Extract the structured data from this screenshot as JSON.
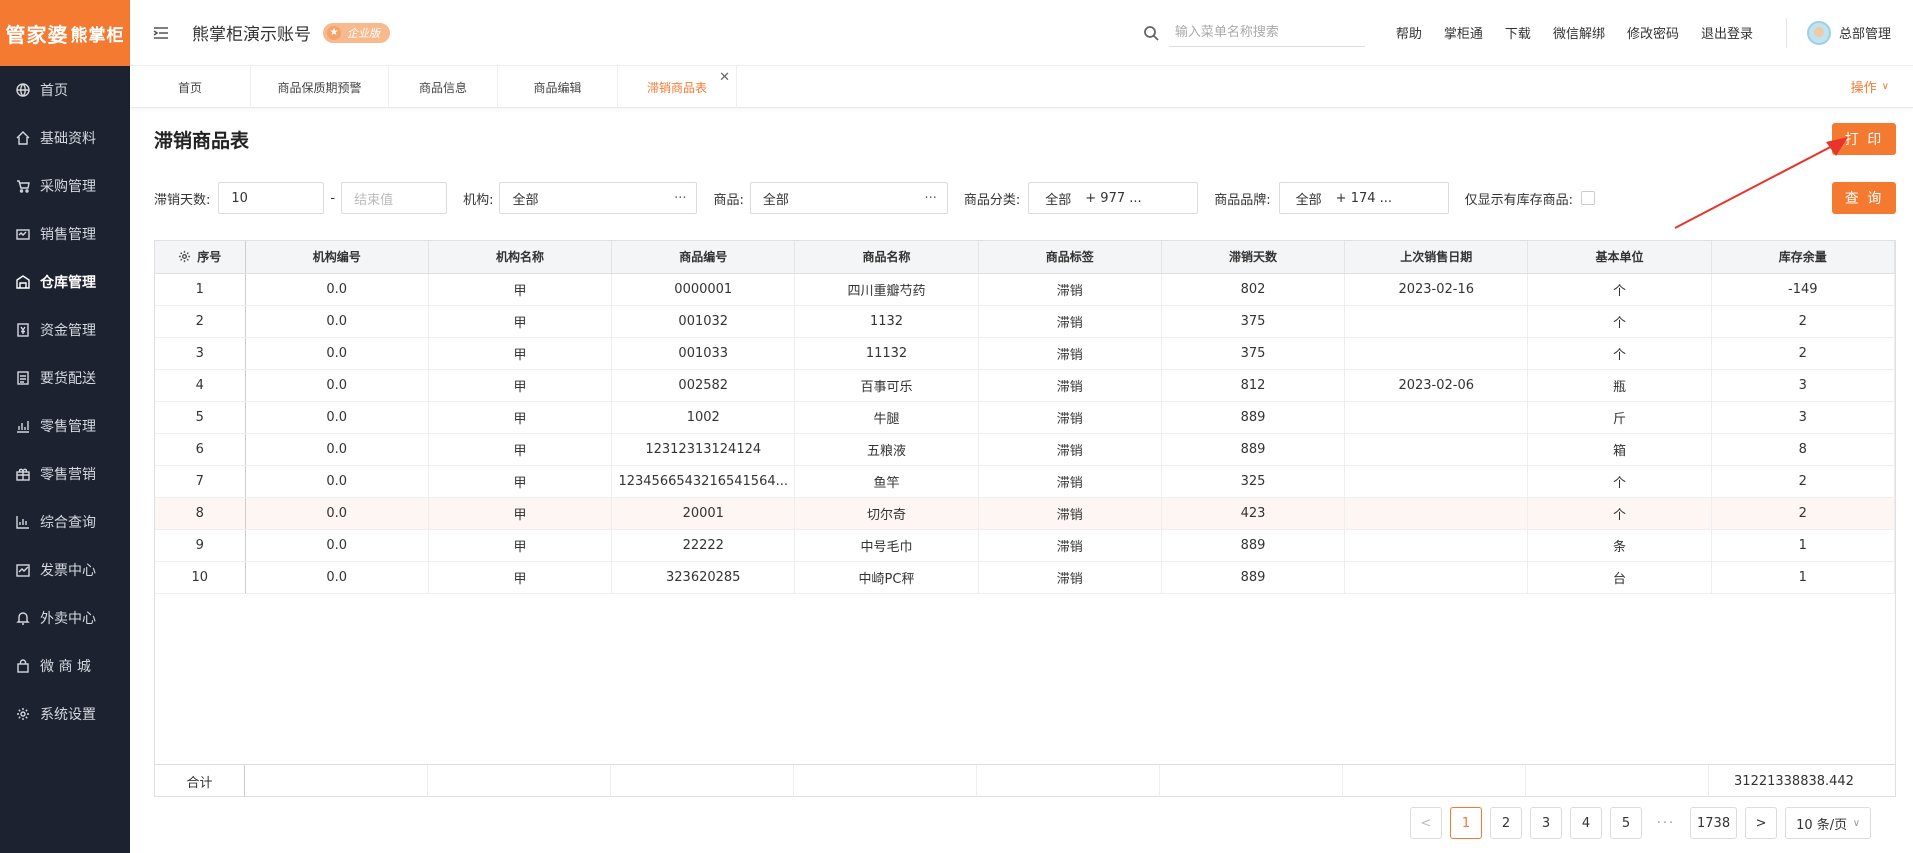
{
  "brand": {
    "logo_main": "管家婆",
    "logo_sub": "熊掌柜",
    "logo_color": "#f47a31"
  },
  "sidebar": {
    "items": [
      {
        "label": "首页",
        "icon": "globe-icon"
      },
      {
        "label": "基础资料",
        "icon": "home-icon"
      },
      {
        "label": "采购管理",
        "icon": "cart-icon"
      },
      {
        "label": "销售管理",
        "icon": "sales-icon"
      },
      {
        "label": "仓库管理",
        "icon": "warehouse-icon",
        "active": true
      },
      {
        "label": "资金管理",
        "icon": "money-icon"
      },
      {
        "label": "要货配送",
        "icon": "list-icon"
      },
      {
        "label": "零售管理",
        "icon": "chart-icon"
      },
      {
        "label": "零售营销",
        "icon": "gift-icon"
      },
      {
        "label": "综合查询",
        "icon": "bar-chart-icon"
      },
      {
        "label": "发票中心",
        "icon": "invoice-icon"
      },
      {
        "label": "外卖中心",
        "icon": "bell-icon"
      },
      {
        "label": "微 商 城",
        "icon": "bag-icon"
      },
      {
        "label": "系统设置",
        "icon": "gear-icon"
      }
    ]
  },
  "header": {
    "account_name": "熊掌柜演示账号",
    "edition_badge": "企业版",
    "search_placeholder": "输入菜单名称搜索",
    "links": [
      "帮助",
      "掌柜通",
      "下载",
      "微信解绑",
      "修改密码",
      "退出登录"
    ],
    "user_name": "总部管理"
  },
  "tabs": {
    "items": [
      {
        "label": "首页"
      },
      {
        "label": "商品保质期预警"
      },
      {
        "label": "商品信息"
      },
      {
        "label": "商品编辑"
      },
      {
        "label": "滞销商品表",
        "active": true,
        "closable": true
      }
    ],
    "operations_label": "操作"
  },
  "page": {
    "title": "滞销商品表",
    "print_label": "打 印",
    "query_label": "查 询"
  },
  "filters": {
    "days_label": "滞销天数:",
    "days_start": "10",
    "days_sep": "-",
    "days_end_placeholder": "结束值",
    "org_label": "机构:",
    "org_value": "全部",
    "goods_label": "商品:",
    "goods_value": "全部",
    "category_label": "商品分类:",
    "category_value": "全部",
    "category_more": "+ 977 ...",
    "brand_label": "商品品牌:",
    "brand_value": "全部",
    "brand_more": "+ 174 ...",
    "stock_only_label": "仅显示有库存商品:"
  },
  "table": {
    "columns": [
      "序号",
      "机构编号",
      "机构名称",
      "商品编号",
      "商品名称",
      "商品标签",
      "滞销天数",
      "上次销售日期",
      "基本单位",
      "库存余量"
    ],
    "rows": [
      [
        "1",
        "0.0",
        "甲",
        "0000001",
        "四川重瓣芍药",
        "滞销",
        "802",
        "2023-02-16",
        "个",
        "-149"
      ],
      [
        "2",
        "0.0",
        "甲",
        "001032",
        "1132",
        "滞销",
        "375",
        "",
        "个",
        "2"
      ],
      [
        "3",
        "0.0",
        "甲",
        "001033",
        "11132",
        "滞销",
        "375",
        "",
        "个",
        "2"
      ],
      [
        "4",
        "0.0",
        "甲",
        "002582",
        "百事可乐",
        "滞销",
        "812",
        "2023-02-06",
        "瓶",
        "3"
      ],
      [
        "5",
        "0.0",
        "甲",
        "1002",
        "牛腿",
        "滞销",
        "889",
        "",
        "斤",
        "3"
      ],
      [
        "6",
        "0.0",
        "甲",
        "12312313124124",
        "五粮液",
        "滞销",
        "889",
        "",
        "箱",
        "8"
      ],
      [
        "7",
        "0.0",
        "甲",
        "1234566543216541564...",
        "鱼竿",
        "滞销",
        "325",
        "",
        "个",
        "2"
      ],
      [
        "8",
        "0.0",
        "甲",
        "20001",
        "切尔奇",
        "滞销",
        "423",
        "",
        "个",
        "2"
      ],
      [
        "9",
        "0.0",
        "甲",
        "22222",
        "中号毛巾",
        "滞销",
        "889",
        "",
        "条",
        "1"
      ],
      [
        "10",
        "0.0",
        "甲",
        "323620285",
        "中崎PC秤",
        "滞销",
        "889",
        "",
        "台",
        "1"
      ]
    ],
    "highlight_row": 8,
    "total_label": "合计",
    "total_stock": "31221338838.442"
  },
  "pagination": {
    "prev": "<",
    "pages": [
      "1",
      "2",
      "3",
      "4",
      "5"
    ],
    "ellipsis": "···",
    "last": "1738",
    "next": ">",
    "page_size": "10 条/页",
    "current": "1"
  }
}
